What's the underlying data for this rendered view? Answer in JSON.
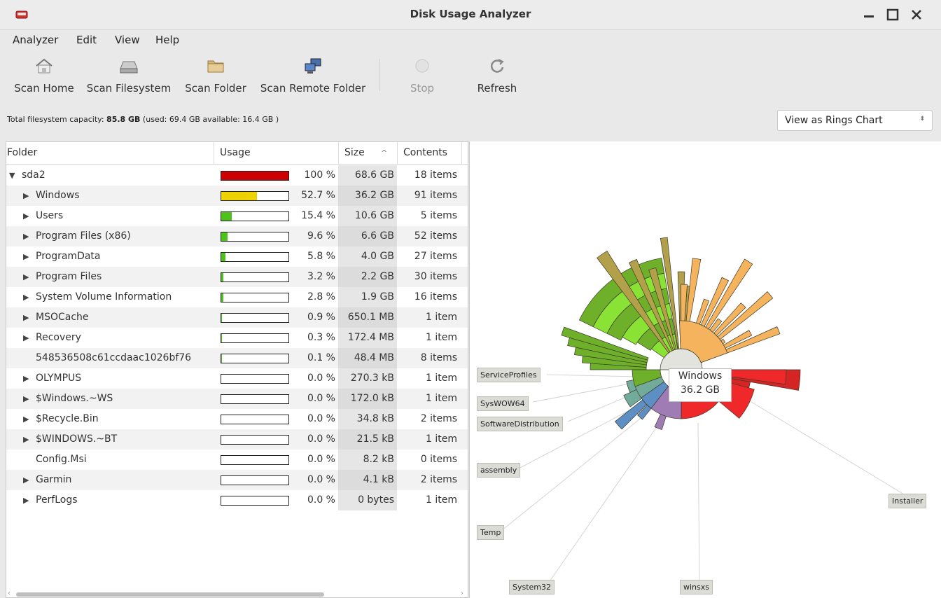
{
  "window": {
    "title": "Disk Usage Analyzer"
  },
  "menu": [
    "Analyzer",
    "Edit",
    "View",
    "Help"
  ],
  "toolbar": {
    "scan_home": "Scan Home",
    "scan_filesystem": "Scan Filesystem",
    "scan_folder": "Scan Folder",
    "scan_remote": "Scan Remote Folder",
    "stop": "Stop",
    "refresh": "Refresh"
  },
  "capacity": {
    "label": "Total filesystem capacity: ",
    "total": "85.8 GB",
    "detail": " (used: 69.4 GB available: 16.4 GB )"
  },
  "view_select": {
    "value": "View as Rings Chart"
  },
  "columns": {
    "folder": "Folder",
    "usage": "Usage",
    "size": "Size",
    "sort_arrow": "^",
    "contents": "Contents"
  },
  "rows": [
    {
      "name": "sda2",
      "expander": "▼",
      "level": 0,
      "usage": 100,
      "percent": "100 %",
      "size": "68.6 GB",
      "contents": "18 items",
      "color": "#cc0000"
    },
    {
      "name": "Windows",
      "expander": "▶",
      "level": 1,
      "usage": 52.7,
      "percent": "52.7 %",
      "size": "36.2 GB",
      "contents": "91 items",
      "color": "#edd400"
    },
    {
      "name": "Users",
      "expander": "▶",
      "level": 1,
      "usage": 15.4,
      "percent": "15.4 %",
      "size": "10.6 GB",
      "contents": "5 items",
      "color": "#4cc21a"
    },
    {
      "name": "Program Files (x86)",
      "expander": "▶",
      "level": 1,
      "usage": 9.6,
      "percent": "9.6 %",
      "size": "6.6 GB",
      "contents": "52 items",
      "color": "#4cc21a"
    },
    {
      "name": "ProgramData",
      "expander": "▶",
      "level": 1,
      "usage": 5.8,
      "percent": "5.8 %",
      "size": "4.0 GB",
      "contents": "27 items",
      "color": "#4cc21a"
    },
    {
      "name": "Program Files",
      "expander": "▶",
      "level": 1,
      "usage": 3.2,
      "percent": "3.2 %",
      "size": "2.2 GB",
      "contents": "30 items",
      "color": "#4cc21a"
    },
    {
      "name": "System Volume Information",
      "expander": "▶",
      "level": 1,
      "usage": 2.8,
      "percent": "2.8 %",
      "size": "1.9 GB",
      "contents": "16 items",
      "color": "#4cc21a"
    },
    {
      "name": "MSOCache",
      "expander": "▶",
      "level": 1,
      "usage": 0.9,
      "percent": "0.9 %",
      "size": "650.1 MB",
      "contents": "1 item",
      "color": "#4cc21a"
    },
    {
      "name": "Recovery",
      "expander": "▶",
      "level": 1,
      "usage": 0.3,
      "percent": "0.3 %",
      "size": "172.4 MB",
      "contents": "1 item",
      "color": "#4cc21a"
    },
    {
      "name": "548536508c61ccdaac1026bf76",
      "expander": "",
      "level": 1,
      "usage": 0.1,
      "percent": "0.1 %",
      "size": "48.4 MB",
      "contents": "8 items",
      "color": "#4cc21a"
    },
    {
      "name": "OLYMPUS",
      "expander": "▶",
      "level": 1,
      "usage": 0,
      "percent": "0.0 %",
      "size": "270.3 kB",
      "contents": "1 item",
      "color": "#4cc21a"
    },
    {
      "name": "$Windows.~WS",
      "expander": "▶",
      "level": 1,
      "usage": 0,
      "percent": "0.0 %",
      "size": "172.0 kB",
      "contents": "1 item",
      "color": "#4cc21a"
    },
    {
      "name": "$Recycle.Bin",
      "expander": "▶",
      "level": 1,
      "usage": 0,
      "percent": "0.0 %",
      "size": "34.8 kB",
      "contents": "2 items",
      "color": "#4cc21a"
    },
    {
      "name": "$WINDOWS.~BT",
      "expander": "▶",
      "level": 1,
      "usage": 0,
      "percent": "0.0 %",
      "size": "21.5 kB",
      "contents": "1 item",
      "color": "#4cc21a"
    },
    {
      "name": "Config.Msi",
      "expander": "",
      "level": 1,
      "usage": 0,
      "percent": "0.0 %",
      "size": "8.2 kB",
      "contents": "0 items",
      "color": "#4cc21a"
    },
    {
      "name": "Garmin",
      "expander": "▶",
      "level": 1,
      "usage": 0,
      "percent": "0.0 %",
      "size": "4.1 kB",
      "contents": "2 items",
      "color": "#4cc21a"
    },
    {
      "name": "PerfLogs",
      "expander": "▶",
      "level": 1,
      "usage": 0,
      "percent": "0.0 %",
      "size": "0 bytes",
      "contents": "1 item",
      "color": "#4cc21a"
    }
  ],
  "chart": {
    "tooltip": {
      "name": "Windows",
      "size": "36.2 GB"
    },
    "labels": [
      "ServiceProfiles",
      "SysWOW64",
      "SoftwareDistribution",
      "assembly",
      "Temp",
      "System32",
      "winsxs",
      "Installer"
    ],
    "colors": {
      "windows": "#ef2929",
      "windows_dark": "#d42424",
      "purple": "#a07cb4",
      "blue": "#5e8fc4",
      "teal": "#73ab9a",
      "green": "#8ae234",
      "green_dark": "#6fb02a",
      "olive": "#b3a04a",
      "orange": "#f5b35e",
      "center": "#e3e3de"
    }
  }
}
